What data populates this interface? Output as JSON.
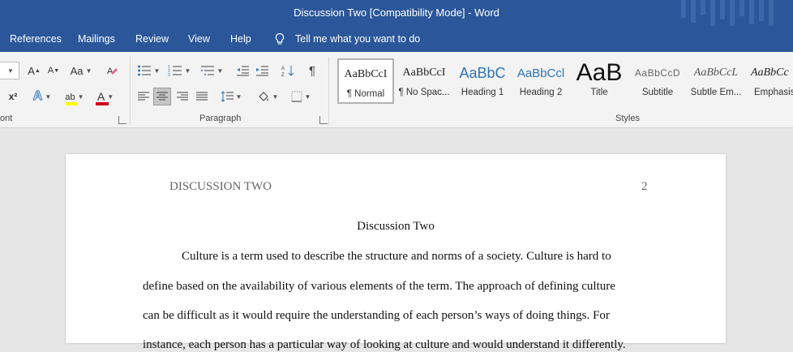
{
  "window": {
    "title": "Discussion Two [Compatibility Mode]  -  Word"
  },
  "menu": {
    "tabs": [
      "References",
      "Mailings",
      "Review",
      "View",
      "Help"
    ],
    "tell_me": "Tell me what you want to do"
  },
  "ribbon": {
    "groups": {
      "font": "ont",
      "paragraph": "Paragraph",
      "styles": "Styles"
    },
    "font": {
      "grow": "A",
      "shrink": "A",
      "case": "Aa",
      "superscript": "x²",
      "text_effects": "A",
      "highlight": "ab",
      "font_color": "A"
    },
    "styles": [
      {
        "preview": "AaBbCcI",
        "name": "¶ Normal",
        "selected": true
      },
      {
        "preview": "AaBbCcI",
        "name": "¶ No Spac..."
      },
      {
        "preview": "AaBbC",
        "name": "Heading 1"
      },
      {
        "preview": "AaBbCcl",
        "name": "Heading 2"
      },
      {
        "preview": "AaB",
        "name": "Title"
      },
      {
        "preview": "AaBbCcD",
        "name": "Subtitle"
      },
      {
        "preview": "AaBbCcL",
        "name": "Subtle Em..."
      },
      {
        "preview": "AaBbCc",
        "name": "Emphasis"
      }
    ],
    "colors": {
      "highlight": "#ffff00",
      "font_color": "#d0021b",
      "brand": "#2b579a"
    }
  },
  "document": {
    "header_left": "DISCUSSION TWO",
    "page_number": "2",
    "title": "Discussion Two",
    "lines": [
      "Culture is a term used to describe the structure and norms of a society. Culture is hard to",
      "define based on the availability of various elements of the term. The approach of defining culture",
      "can be difficult as it would require the understanding of each person’s ways of doing things. For",
      "instance, each person has a particular way of looking at culture and would understand it differently."
    ]
  }
}
